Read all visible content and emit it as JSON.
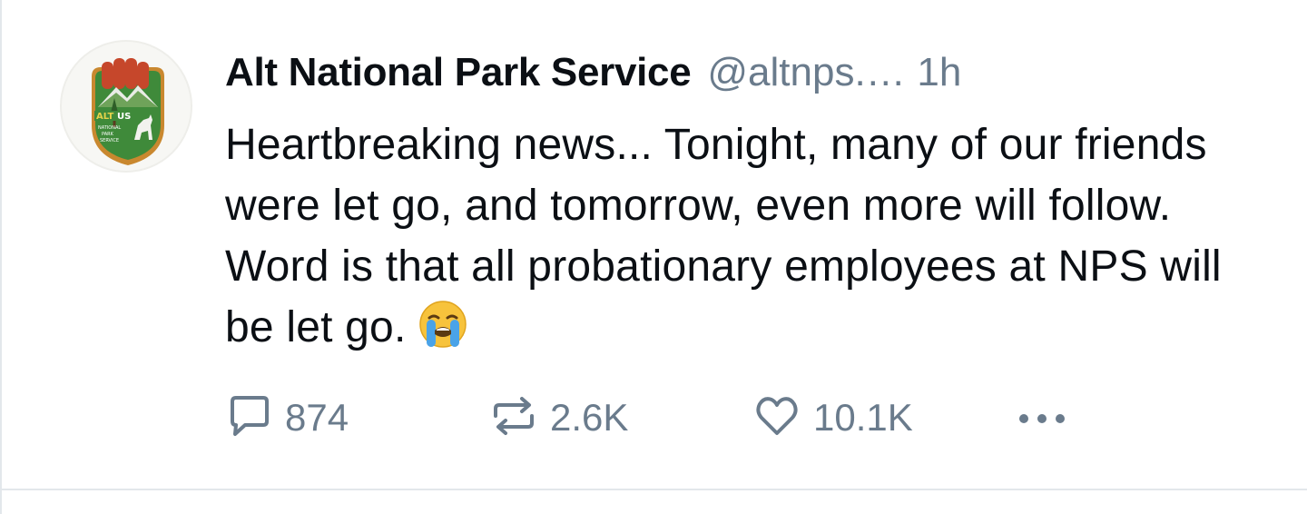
{
  "post": {
    "author": {
      "display_name": "Alt National Park Service",
      "handle": "@altnps.bsky.s...",
      "avatar_logo_text": "ALT US NATIONAL PARK SERVICE"
    },
    "timestamp": "1h",
    "text": "Heartbreaking news... Tonight, many of our friends were let go, and tomorrow, even more will follow. Word is that all probationary employees at NPS will be let go.",
    "emoji": "crying-face",
    "actions": {
      "replies": "874",
      "reposts": "2.6K",
      "likes": "10.1K"
    }
  },
  "colors": {
    "text": "#0b0f14",
    "muted": "#6a7b8c",
    "divider": "#e3e7eb"
  },
  "icons": [
    "reply-icon",
    "repost-icon",
    "like-icon",
    "more-icon",
    "crying-emoji-icon"
  ]
}
